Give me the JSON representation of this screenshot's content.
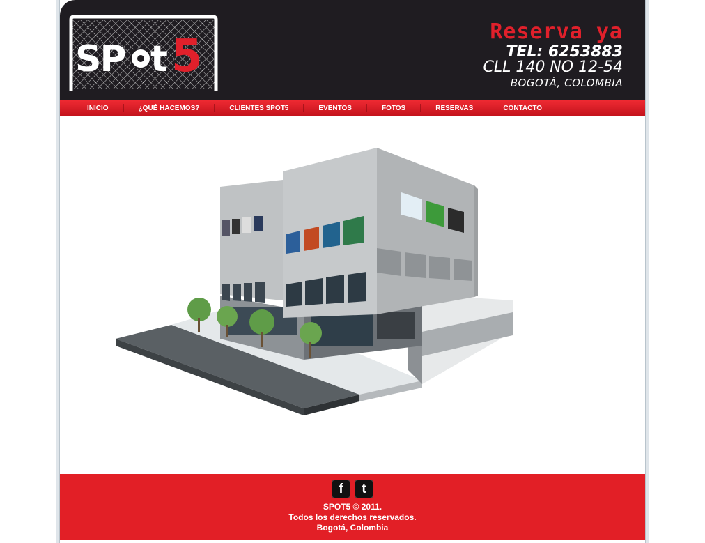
{
  "header": {
    "logo_text": "SPOT5",
    "reserva": "Reserva ya",
    "tel": "TEL: 6253883",
    "address": "CLL 140 NO 12-54",
    "city": "BOGOTÁ, COLOMBIA"
  },
  "nav": {
    "items": [
      {
        "label": "INICIO"
      },
      {
        "label": "¿QUÉ HACEMOS?"
      },
      {
        "label": "CLIENTES SPOT5"
      },
      {
        "label": "EVENTOS"
      },
      {
        "label": "FOTOS"
      },
      {
        "label": "RESERVAS"
      },
      {
        "label": "CONTACTO"
      }
    ]
  },
  "footer": {
    "social": [
      {
        "icon": "facebook-icon",
        "glyph": "f"
      },
      {
        "icon": "twitter-icon",
        "glyph": "t"
      }
    ],
    "copyright": "SPOT5 © 2011.",
    "rights": "Todos los derechos reservados.",
    "location": "Bogotá, Colombia"
  },
  "colors": {
    "brand_red": "#e21f26",
    "header_dark": "#1f1c21"
  }
}
